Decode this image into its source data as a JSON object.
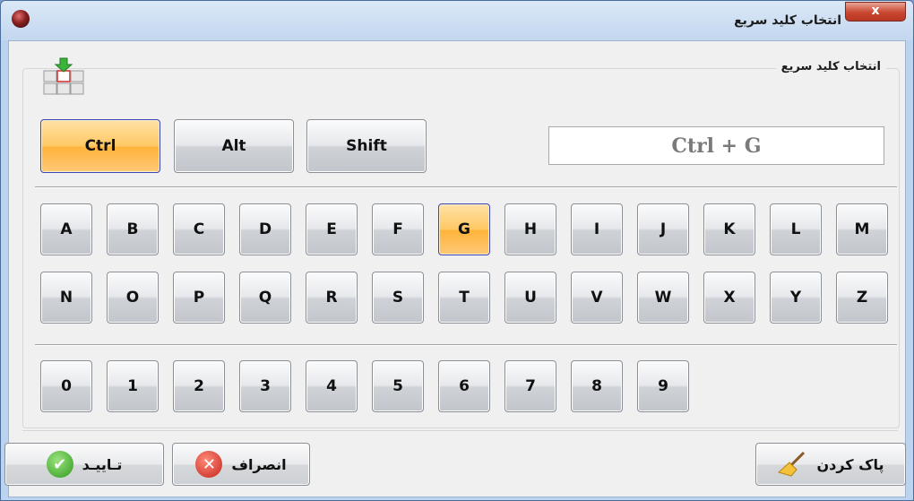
{
  "window": {
    "title": "انتخاب کلید سریع",
    "close_label": "x"
  },
  "group": {
    "title": "انتخاب کلید سریع"
  },
  "modifiers": [
    {
      "label": "Ctrl",
      "active": true
    },
    {
      "label": "Alt",
      "active": false
    },
    {
      "label": "Shift",
      "active": false
    }
  ],
  "display": {
    "value": "Ctrl + G"
  },
  "letters_row1": [
    "A",
    "B",
    "C",
    "D",
    "E",
    "F",
    "G",
    "H",
    "I",
    "J",
    "K",
    "L",
    "M"
  ],
  "letters_row2": [
    "N",
    "O",
    "P",
    "Q",
    "R",
    "S",
    "T",
    "U",
    "V",
    "W",
    "X",
    "Y",
    "Z"
  ],
  "digits": [
    "0",
    "1",
    "2",
    "3",
    "4",
    "5",
    "6",
    "7",
    "8",
    "9"
  ],
  "selected_letter": "G",
  "footer": {
    "confirm_label": "تـاییـد",
    "cancel_label": "انصراف",
    "clear_label": "پاک کردن"
  },
  "colors": {
    "active_key": "#ffc864",
    "active_border": "#3a45b8",
    "confirm_icon": "#3fae2a",
    "cancel_icon": "#d0342c"
  },
  "icons": {
    "app": "app-icon",
    "keyboard": "keyboard-icon",
    "confirm": "check-icon",
    "cancel": "x-circle-icon",
    "clear": "broom-icon"
  }
}
